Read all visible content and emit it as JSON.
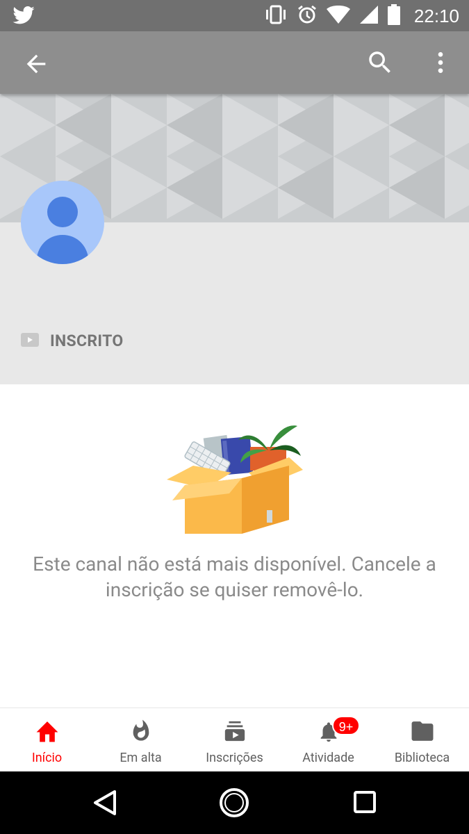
{
  "status_bar": {
    "time": "22:10",
    "icons": [
      "twitter-icon",
      "vibrate-icon",
      "alarm-icon",
      "wifi-icon",
      "signal-icon",
      "battery-icon"
    ]
  },
  "toolbar": {
    "icons": [
      "back-arrow-icon",
      "search-icon",
      "more-vert-icon"
    ]
  },
  "channel": {
    "subscribed_label": "INSCRITO",
    "empty_message": "Este canal não está mais disponível. Cancele a inscrição se quiser removê-lo."
  },
  "bottom_nav": {
    "items": [
      {
        "label": "Início",
        "icon": "home-icon",
        "active": true
      },
      {
        "label": "Em alta",
        "icon": "trending-flame-icon",
        "active": false
      },
      {
        "label": "Inscrições",
        "icon": "subscriptions-icon",
        "active": false
      },
      {
        "label": "Atividade",
        "icon": "bell-icon",
        "active": false
      },
      {
        "label": "Biblioteca",
        "icon": "folder-icon",
        "active": false
      }
    ],
    "activity_badge": "9+"
  },
  "colors": {
    "accent": "#ff0000",
    "status_bar": "#707070",
    "toolbar": "#8e8e8e",
    "header_bg": "#e8e8e8",
    "avatar_bg": "#a8c7fa",
    "avatar_fg": "#4a7fe0"
  }
}
